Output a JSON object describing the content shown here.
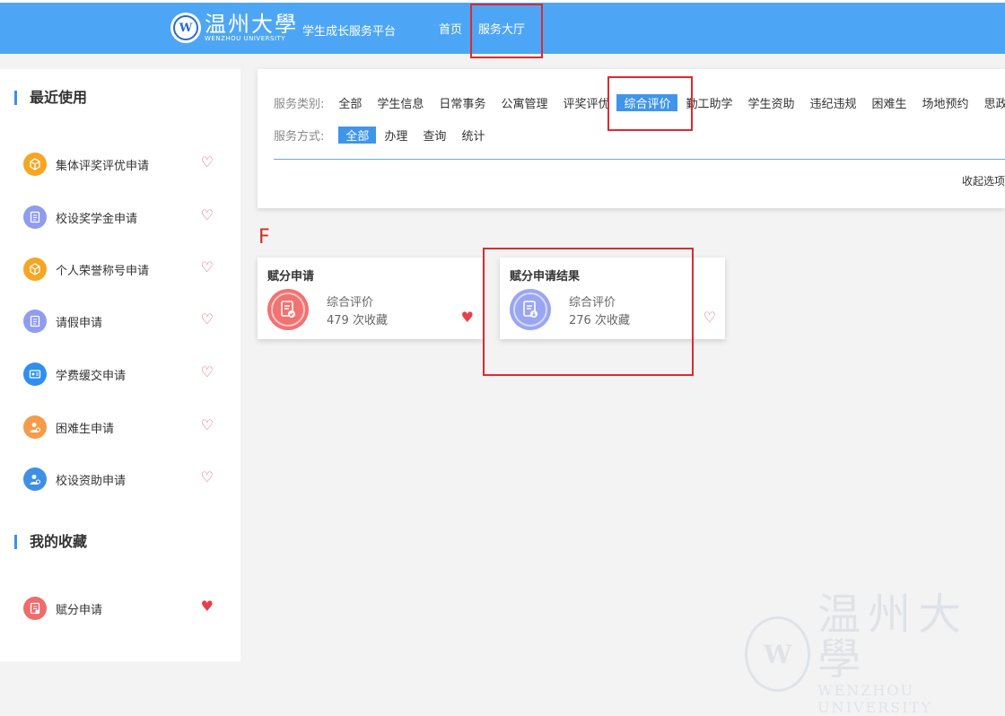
{
  "header": {
    "logo_cn": "温州大學",
    "logo_en": "WENZHOU UNIVERSITY",
    "platform_name": "学生成长服务平台",
    "nav": {
      "home": "首页",
      "hall": "服务大厅"
    }
  },
  "sidebar": {
    "recent_title": "最近使用",
    "recent_items": [
      {
        "label": "集体评奖评优申请",
        "icon": "box-icon",
        "color": "#f5a623",
        "favorited": false
      },
      {
        "label": "校设奖学金申请",
        "icon": "document-icon",
        "color": "#8f9cf0",
        "favorited": false
      },
      {
        "label": "个人荣誉称号申请",
        "icon": "box-icon",
        "color": "#f5a623",
        "favorited": false
      },
      {
        "label": "请假申请",
        "icon": "document-icon",
        "color": "#8f9cf0",
        "favorited": false
      },
      {
        "label": "学费缓交申请",
        "icon": "card-icon",
        "color": "#2f8ff0",
        "favorited": false
      },
      {
        "label": "困难生申请",
        "icon": "person-icon",
        "color": "#f59b4a",
        "favorited": false
      },
      {
        "label": "校设资助申请",
        "icon": "person-icon",
        "color": "#3f8fe6",
        "favorited": false
      }
    ],
    "favorites_title": "我的收藏",
    "favorite_items": [
      {
        "label": "赋分申请",
        "icon": "document-icon",
        "color": "#f06b6b",
        "favorited": true
      }
    ]
  },
  "filter": {
    "category_label": "服务类别:",
    "categories": [
      "全部",
      "学生信息",
      "日常事务",
      "公寓管理",
      "评奖评优",
      "综合评价",
      "勤工助学",
      "学生资助",
      "违纪违规",
      "困难生",
      "场地预约",
      "思政"
    ],
    "active_category": "综合评价",
    "mode_label": "服务方式:",
    "modes": [
      "全部",
      "办理",
      "查询",
      "统计"
    ],
    "active_mode": "全部",
    "collapse_label": "收起选项"
  },
  "group_letter": "F",
  "services": [
    {
      "title": "赋分申请",
      "category": "综合评价",
      "count_text": "479 次收藏",
      "favorited": true,
      "icon": "document-check-icon",
      "color": "#f27272"
    },
    {
      "title": "赋分申请结果",
      "category": "综合评价",
      "count_text": "276 次收藏",
      "favorited": false,
      "icon": "document-download-icon",
      "color": "#9aa6f2"
    }
  ],
  "colors": {
    "header_blue": "#4da6f5",
    "accent": "#3f95ea",
    "highlight_box": "#e0292f",
    "heart": "#e8606a"
  }
}
